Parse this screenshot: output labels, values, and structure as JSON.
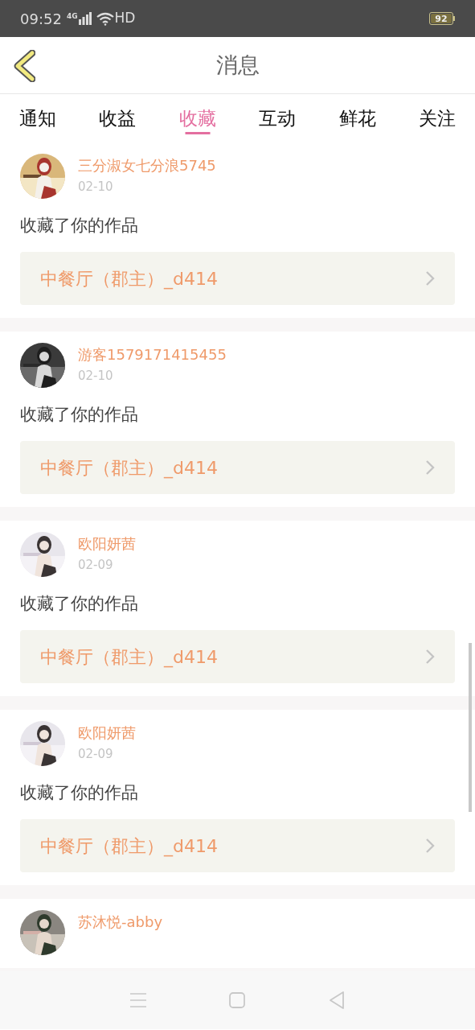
{
  "status_bar": {
    "time": "09:52",
    "network": "4G",
    "hd": "HD",
    "battery": "92"
  },
  "header": {
    "title": "消息"
  },
  "tabs": [
    {
      "label": "通知",
      "selected": false
    },
    {
      "label": "收益",
      "selected": false
    },
    {
      "label": "收藏",
      "selected": true
    },
    {
      "label": "互动",
      "selected": false
    },
    {
      "label": "鲜花",
      "selected": false
    },
    {
      "label": "关注",
      "selected": false
    }
  ],
  "messages": [
    {
      "user": "三分淑女七分浪5745",
      "date": "02-10",
      "action": "收藏了你的作品",
      "work": "中餐厅（郡主）_d414"
    },
    {
      "user": "游客1579171415455",
      "date": "02-10",
      "action": "收藏了你的作品",
      "work": "中餐厅（郡主）_d414"
    },
    {
      "user": "欧阳妍茜",
      "date": "02-09",
      "action": "收藏了你的作品",
      "work": "中餐厅（郡主）_d414"
    },
    {
      "user": "欧阳妍茜",
      "date": "02-09",
      "action": "收藏了你的作品",
      "work": "中餐厅（郡主）_d414"
    },
    {
      "user": "苏沐悦-abby"
    }
  ]
}
